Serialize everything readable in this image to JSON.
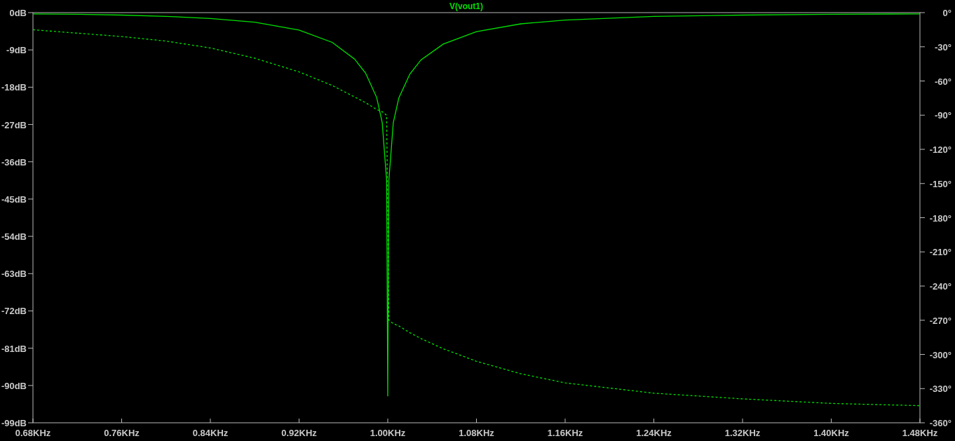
{
  "plot": {
    "chart_data": {
      "type": "line",
      "title": "V(vout1)",
      "x": [
        0.68,
        0.72,
        0.76,
        0.8,
        0.84,
        0.88,
        0.92,
        0.95,
        0.97,
        0.98,
        0.99,
        0.995,
        0.999,
        1.0,
        1.001,
        1.005,
        1.01,
        1.02,
        1.03,
        1.05,
        1.08,
        1.12,
        1.16,
        1.24,
        1.32,
        1.4,
        1.48
      ],
      "xlim": [
        0.68,
        1.48
      ],
      "xticks": [
        {
          "value": 0.68,
          "label": "0.68KHz"
        },
        {
          "value": 0.76,
          "label": "0.76KHz"
        },
        {
          "value": 0.84,
          "label": "0.84KHz"
        },
        {
          "value": 0.92,
          "label": "0.92KHz"
        },
        {
          "value": 1.0,
          "label": "1.00KHz"
        },
        {
          "value": 1.08,
          "label": "1.08KHz"
        },
        {
          "value": 1.16,
          "label": "1.16KHz"
        },
        {
          "value": 1.24,
          "label": "1.24KHz"
        },
        {
          "value": 1.32,
          "label": "1.32KHz"
        },
        {
          "value": 1.4,
          "label": "1.40KHz"
        },
        {
          "value": 1.48,
          "label": "1.48KHz"
        }
      ],
      "ylim": [
        -99,
        0
      ],
      "yticks": [
        {
          "value": 0,
          "label": "0dB"
        },
        {
          "value": -9,
          "label": "-9dB"
        },
        {
          "value": -18,
          "label": "-18dB"
        },
        {
          "value": -27,
          "label": "-27dB"
        },
        {
          "value": -36,
          "label": "-36dB"
        },
        {
          "value": -45,
          "label": "-45dB"
        },
        {
          "value": -54,
          "label": "-54dB"
        },
        {
          "value": -63,
          "label": "-63dB"
        },
        {
          "value": -72,
          "label": "-72dB"
        },
        {
          "value": -81,
          "label": "-81dB"
        },
        {
          "value": -90,
          "label": "-90dB"
        },
        {
          "value": -99,
          "label": "-99dB"
        }
      ],
      "y2lim": [
        -360,
        0
      ],
      "y2ticks": [
        {
          "value": 0,
          "label": "0°"
        },
        {
          "value": -30,
          "label": "-30°"
        },
        {
          "value": -60,
          "label": "-60°"
        },
        {
          "value": -90,
          "label": "-90°"
        },
        {
          "value": -120,
          "label": "-120°"
        },
        {
          "value": -150,
          "label": "-150°"
        },
        {
          "value": -180,
          "label": "-180°"
        },
        {
          "value": -210,
          "label": "-210°"
        },
        {
          "value": -240,
          "label": "-240°"
        },
        {
          "value": -270,
          "label": "-270°"
        },
        {
          "value": -300,
          "label": "-300°"
        },
        {
          "value": -330,
          "label": "-330°"
        },
        {
          "value": -360,
          "label": "-360°"
        }
      ],
      "series": [
        {
          "color": "#00e000",
          "line_style": "solid",
          "values": [
            -0.3,
            -0.4,
            -0.6,
            -0.9,
            -1.4,
            -2.3,
            -4.2,
            -7.2,
            -11.2,
            -14.6,
            -20.5,
            -26.5,
            -40.5,
            -92.6,
            -40.5,
            -26.6,
            -20.6,
            -14.8,
            -11.4,
            -7.6,
            -4.6,
            -2.7,
            -1.8,
            -0.9,
            -0.6,
            -0.4,
            -0.3
          ]
        },
        {
          "color": "#00e000",
          "axis": "y2",
          "line_style": "dashed",
          "values": [
            -15,
            -18,
            -21,
            -25,
            -31,
            -40,
            -52,
            -64,
            -74,
            -79,
            -85,
            -87,
            -90,
            -180,
            -270,
            -273,
            -275,
            -281,
            -286,
            -295,
            -306,
            -317,
            -325,
            -334,
            -339,
            -343,
            -345
          ]
        }
      ]
    }
  }
}
